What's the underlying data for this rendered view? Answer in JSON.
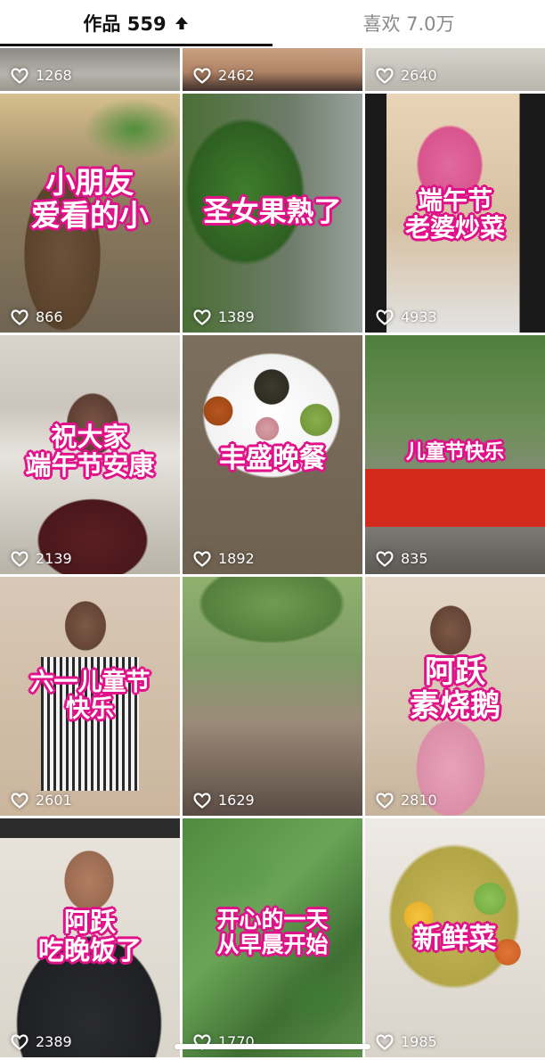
{
  "tabs": {
    "works_label": "作品 559",
    "likes_label": "喜欢 7.0万"
  },
  "icons": {
    "sort": "arrow-up-icon",
    "like": "heart-outline-icon"
  },
  "colors": {
    "caption_stroke": "#e0138a",
    "active_tab": "#111111",
    "inactive_tab": "#8a8a8a"
  },
  "videos": [
    {
      "likes": "1268",
      "caption": ""
    },
    {
      "likes": "2462",
      "caption": ""
    },
    {
      "likes": "2640",
      "caption": ""
    },
    {
      "likes": "866",
      "caption": "小朋友\n爱看的小"
    },
    {
      "likes": "1389",
      "caption": "圣女果熟了"
    },
    {
      "likes": "4933",
      "caption": "端午节\n老婆炒菜"
    },
    {
      "likes": "2139",
      "caption": "祝大家\n端午节安康"
    },
    {
      "likes": "1892",
      "caption": "丰盛晚餐"
    },
    {
      "likes": "835",
      "caption": "儿童节快乐"
    },
    {
      "likes": "2601",
      "caption": "六一儿童节\n快乐"
    },
    {
      "likes": "1629",
      "caption": ""
    },
    {
      "likes": "2810",
      "caption": "阿跃\n素烧鹅"
    },
    {
      "likes": "2389",
      "caption": "阿跃\n吃晚饭了"
    },
    {
      "likes": "1770",
      "caption": "开心的一天\n从早晨开始"
    },
    {
      "likes": "1985",
      "caption": "新鲜菜"
    }
  ]
}
